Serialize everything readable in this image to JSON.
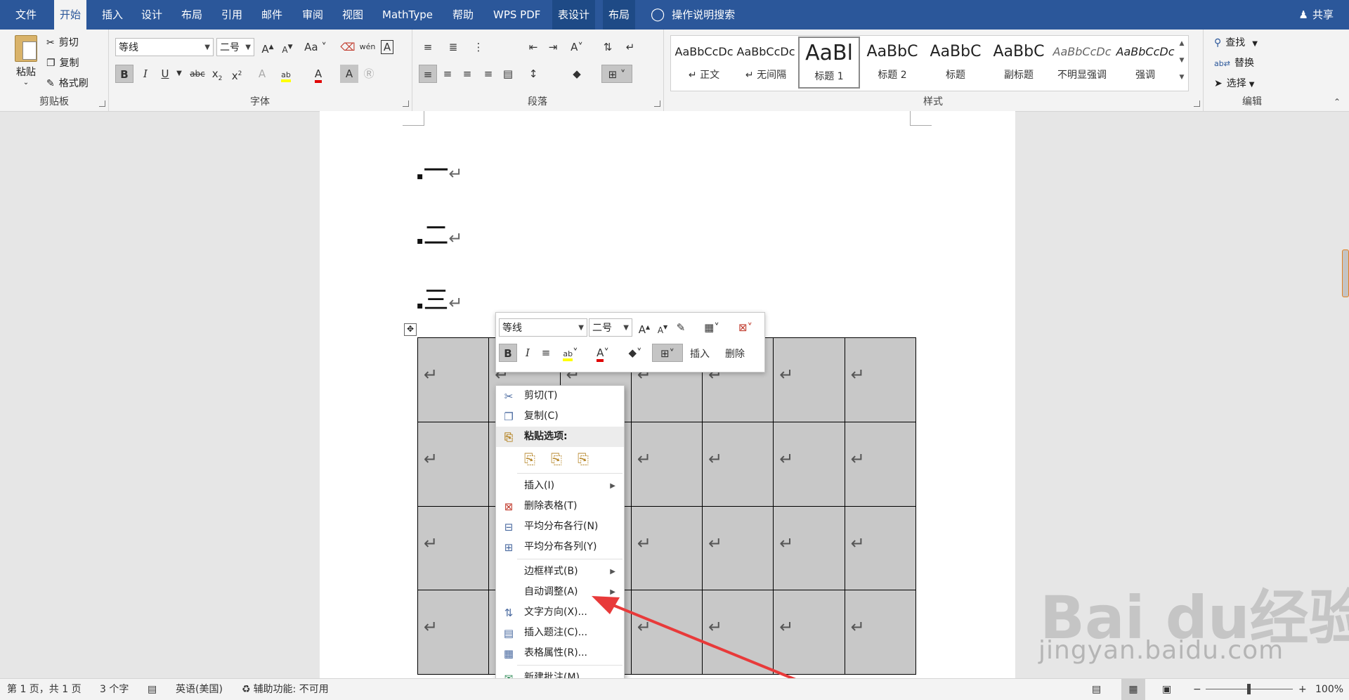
{
  "menubar": {
    "tabs": [
      "文件",
      "开始",
      "插入",
      "设计",
      "布局",
      "引用",
      "邮件",
      "审阅",
      "视图",
      "MathType",
      "帮助",
      "WPS PDF",
      "表设计",
      "布局"
    ],
    "search": "操作说明搜索",
    "share": "共享"
  },
  "clipboard": {
    "paste": "粘贴",
    "cut": "剪切",
    "copy": "复制",
    "format_painter": "格式刷",
    "label": "剪贴板"
  },
  "font": {
    "name": "等线",
    "size": "二号",
    "label": "字体"
  },
  "paragraph": {
    "label": "段落"
  },
  "styles": {
    "items": [
      {
        "sample": "AaBbCcDc",
        "name": "↵ 正文"
      },
      {
        "sample": "AaBbCcDc",
        "name": "↵ 无间隔"
      },
      {
        "sample": "AaBl",
        "name": "标题 1"
      },
      {
        "sample": "AaBbC",
        "name": "标题 2"
      },
      {
        "sample": "AaBbC",
        "name": "标题"
      },
      {
        "sample": "AaBbC",
        "name": "副标题"
      },
      {
        "sample": "AaBbCcDc",
        "name": "不明显强调"
      },
      {
        "sample": "AaBbCcDc",
        "name": "强调"
      }
    ],
    "label": "样式"
  },
  "editing": {
    "find": "查找",
    "replace": "替换",
    "select": "选择",
    "label": "编辑"
  },
  "document": {
    "lines": [
      "一",
      "二",
      "三"
    ],
    "para_mark": "↵"
  },
  "mini_toolbar": {
    "font": "等线",
    "size": "二号",
    "insert": "插入",
    "delete": "删除"
  },
  "context_menu": {
    "cut": "剪切(T)",
    "copy": "复制(C)",
    "paste_options": "粘贴选项:",
    "insert": "插入(I)",
    "delete_table": "删除表格(T)",
    "distribute_rows": "平均分布各行(N)",
    "distribute_cols": "平均分布各列(Y)",
    "border_styles": "边框样式(B)",
    "autofit": "自动调整(A)",
    "text_direction": "文字方向(X)...",
    "insert_caption": "插入题注(C)...",
    "table_properties": "表格属性(R)...",
    "new_comment": "新建批注(M)"
  },
  "status": {
    "page": "第 1 页，共 1 页",
    "words": "3 个字",
    "language": "英语(美国)",
    "accessibility": "辅助功能: 不可用",
    "zoom": "100%"
  },
  "watermark": {
    "brand": "Bai du经验",
    "url": "jingyan.baidu.com"
  },
  "colors": {
    "accent": "#2b579a",
    "highlight": "#ffff00",
    "font_red": "#e00000",
    "arrow": "#e83a3a"
  }
}
